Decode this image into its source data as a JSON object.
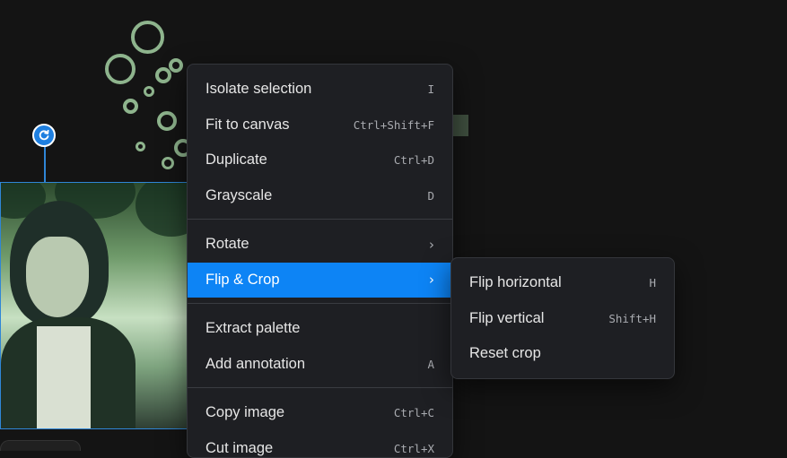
{
  "colors": {
    "background": "#141414",
    "menu_bg": "#1e1f23",
    "highlight": "#0d84f5",
    "selection_border": "#2f86d6",
    "bubble": "#9bc59a"
  },
  "icons": {
    "rotate_handle": "rotate-icon",
    "submenu": "chevron-right-icon"
  },
  "context_menu": {
    "groups": [
      [
        {
          "label": "Isolate selection",
          "shortcut": "I"
        },
        {
          "label": "Fit to canvas",
          "shortcut": "Ctrl+Shift+F"
        },
        {
          "label": "Duplicate",
          "shortcut": "Ctrl+D"
        },
        {
          "label": "Grayscale",
          "shortcut": "D"
        }
      ],
      [
        {
          "label": "Rotate",
          "submenu": true
        },
        {
          "label": "Flip & Crop",
          "submenu": true,
          "active": true
        }
      ],
      [
        {
          "label": "Extract palette",
          "shortcut": ""
        },
        {
          "label": "Add annotation",
          "shortcut": "A"
        }
      ],
      [
        {
          "label": "Copy image",
          "shortcut": "Ctrl+C"
        },
        {
          "label": "Cut image",
          "shortcut": "Ctrl+X"
        }
      ]
    ]
  },
  "submenu": {
    "parent": "Flip & Crop",
    "items": [
      {
        "label": "Flip horizontal",
        "shortcut": "H"
      },
      {
        "label": "Flip vertical",
        "shortcut": "Shift+H"
      },
      {
        "label": "Reset crop",
        "shortcut": ""
      }
    ]
  }
}
